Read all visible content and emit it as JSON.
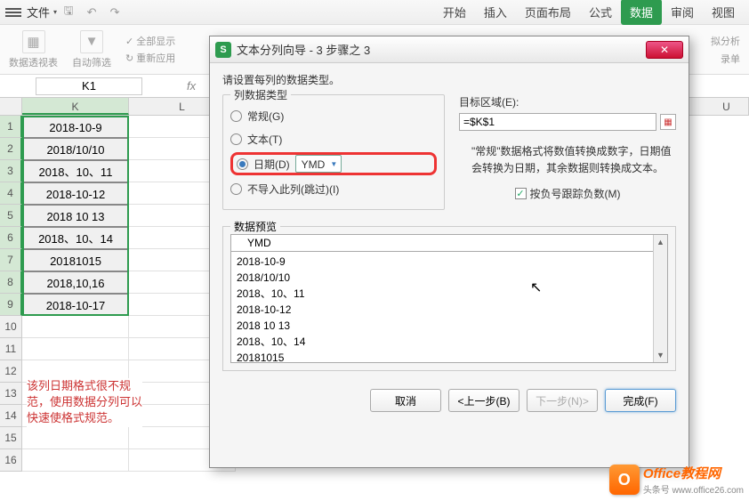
{
  "ribbon": {
    "file": "文件",
    "tabs": [
      "开始",
      "插入",
      "页面布局",
      "公式",
      "数据",
      "审阅",
      "视图"
    ],
    "active_tab": "数据",
    "group1_label": "数据透视表",
    "group2_label": "自动筛选",
    "show_all": "全部显示",
    "reapply": "重新应用",
    "sim_analysis_cut": "拟分析",
    "record_cut": "录单"
  },
  "namebox": "K1",
  "columns": [
    "K",
    "L"
  ],
  "col_u": "U",
  "rowdata": [
    "2018-10-9",
    "2018/10/10",
    "2018、10、11",
    "2018-10-12",
    "2018 10 13",
    "2018、10、14",
    "20181015",
    "2018,10,16",
    "2018-10-17"
  ],
  "note_text": "该列日期格式很不规范，使用数据分列可以快速使格式规范。",
  "dialog": {
    "title": "文本分列向导 - 3 步骤之 3",
    "instruction": "请设置每列的数据类型。",
    "group_title": "列数据类型",
    "radio_general": "常规(G)",
    "radio_text": "文本(T)",
    "radio_date": "日期(D)",
    "date_format": "YMD",
    "radio_skip": "不导入此列(跳过)(I)",
    "target_label": "目标区域(E):",
    "target_value": "=$K$1",
    "description": "\"常规\"数据格式将数值转换成数字，日期值会转换为日期，其余数据则转换成文本。",
    "checkbox_label": "按负号跟踪负数(M)",
    "preview_title": "数据预览",
    "preview_header": "YMD",
    "preview_rows": [
      "2018-10-9",
      "2018/10/10",
      "2018、10、11",
      "2018-10-12",
      "2018 10 13",
      "2018、10、14",
      "20181015"
    ],
    "btn_cancel": "取消",
    "btn_back": "<上一步(B)",
    "btn_next": "下一步(N)>",
    "btn_finish": "完成(F)"
  },
  "watermark": {
    "badge": "O",
    "text": "Office教程网",
    "sub": "头条号 www.office26.com"
  }
}
